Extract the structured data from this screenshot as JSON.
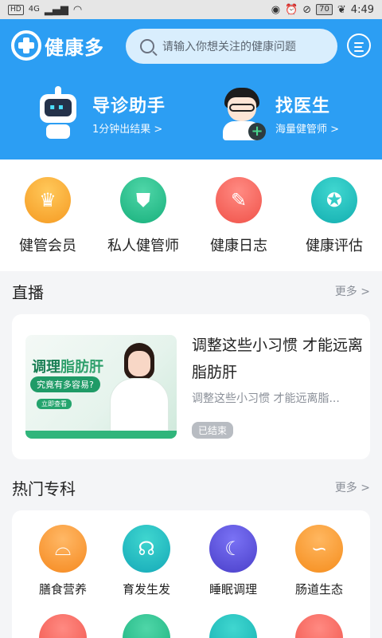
{
  "status_bar": {
    "left_badge": "HD",
    "network": "4G",
    "battery": "70",
    "time": "4:49"
  },
  "header": {
    "app_name": "健康多",
    "search_placeholder": "请输入你想关注的健康问题"
  },
  "features": [
    {
      "title": "导诊助手",
      "subtitle": "1分钟出结果 >",
      "icon": "robot-icon"
    },
    {
      "title": "找医生",
      "subtitle": "海量健管师 >",
      "icon": "doctor-icon"
    }
  ],
  "quick_entries": [
    {
      "label": "健管会员",
      "icon": "crown-icon",
      "color": "#f5a623"
    },
    {
      "label": "私人健管师",
      "icon": "doctor-badge-icon",
      "color": "#1fb482"
    },
    {
      "label": "健康日志",
      "icon": "pencil-icon",
      "color": "#f2564d"
    },
    {
      "label": "健康评估",
      "icon": "award-icon",
      "color": "#16b0b2"
    }
  ],
  "live": {
    "section_title": "直播",
    "more_label": "更多 >",
    "card": {
      "title": "调整这些小习惯 才能远离脂肪肝",
      "description": "调整这些小习惯 才能远离脂...",
      "status": "已结束",
      "thumb_line1_prefix": "调理",
      "thumb_line1_highlight": "脂肪肝",
      "thumb_line2": "究竟有多容易?",
      "thumb_cta": "立即查看"
    }
  },
  "departments": {
    "section_title": "热门专科",
    "more_label": "更多 >",
    "items": [
      {
        "label": "膳食营养",
        "icon": "cloche-icon"
      },
      {
        "label": "育发生发",
        "icon": "head-profile-icon"
      },
      {
        "label": "睡眠调理",
        "icon": "moon-sleep-icon"
      },
      {
        "label": "肠道生态",
        "icon": "stomach-icon"
      }
    ]
  }
}
